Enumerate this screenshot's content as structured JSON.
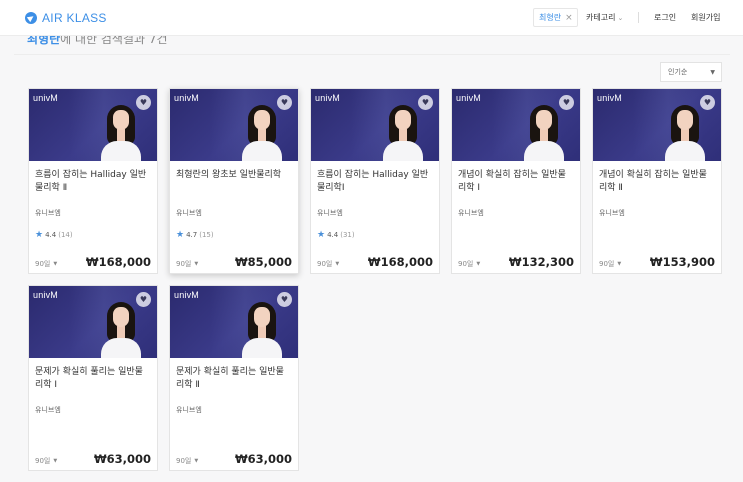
{
  "header": {
    "logo_text": "AIR KLASS",
    "search_chip": "최형란",
    "close_glyph": "×",
    "category_label": "카테고리",
    "login_label": "로그인",
    "signup_label": "회원가입"
  },
  "results": {
    "keyword": "최형란",
    "suffix": "에 대한 검색결과 7건"
  },
  "sort": {
    "label": "인기순"
  },
  "card_common": {
    "brand": "univM",
    "period": "90일"
  },
  "cards": [
    {
      "title": "흐름이 잡히는 Halliday 일반물리학 Ⅱ",
      "teacher": "유니브엠",
      "rating": "4.4",
      "count": "(14)",
      "price": "₩168,000"
    },
    {
      "title": "최형란의 왕초보 일반물리학",
      "teacher": "유니브엠",
      "rating": "4.7",
      "count": "(15)",
      "price": "₩85,000"
    },
    {
      "title": "흐름이 잡히는 Halliday 일반물리학Ⅰ",
      "teacher": "유니브엠",
      "rating": "4.4",
      "count": "(31)",
      "price": "₩168,000"
    },
    {
      "title": "개념이 확실히 잡히는 일반물리학 Ⅰ",
      "teacher": "유니브엠",
      "price": "₩132,300"
    },
    {
      "title": "개념이 확실히 잡히는 일반물리학 Ⅱ",
      "teacher": "유니브엠",
      "price": "₩153,900"
    },
    {
      "title": "문제가 확실히 풀리는 일반물리학 Ⅰ",
      "teacher": "유니브엠",
      "price": "₩63,000"
    },
    {
      "title": "문제가 확실히 풀리는 일반물리학 Ⅱ",
      "teacher": "유니브엠",
      "price": "₩63,000"
    }
  ],
  "colors": {
    "accent": "#3d8fe6",
    "thumb_bg": "#2b2a6e",
    "star": "#4a90d9"
  }
}
